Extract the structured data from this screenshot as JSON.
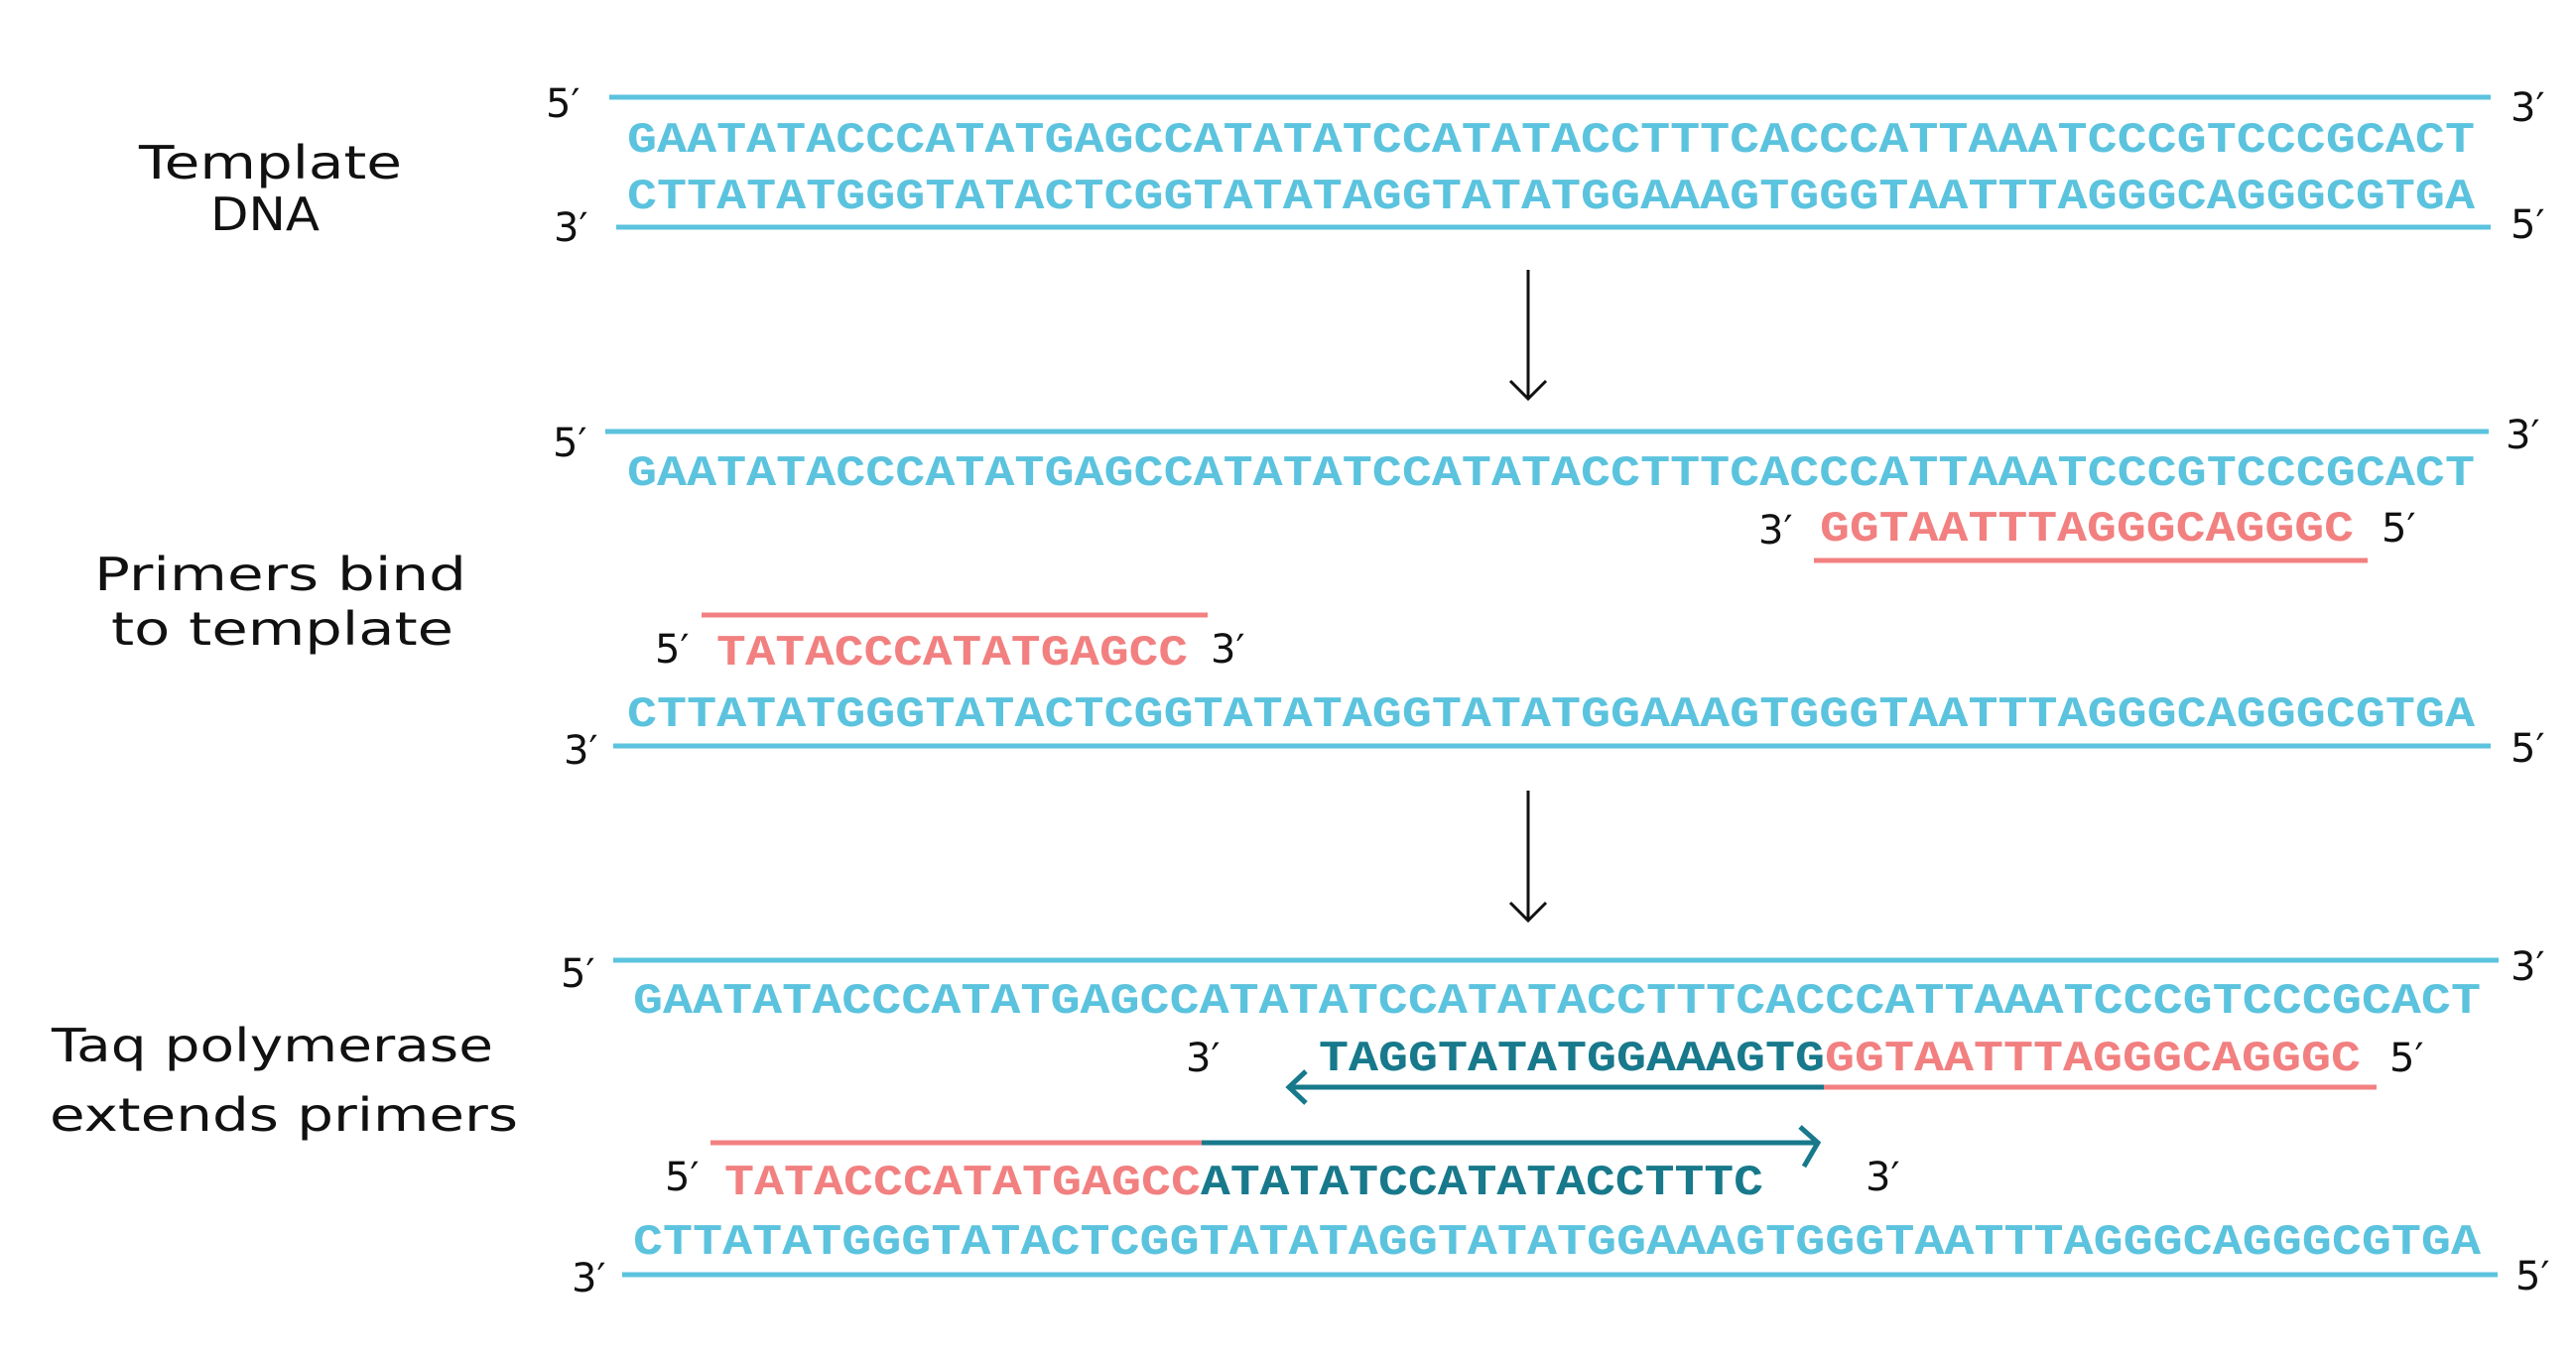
{
  "labels": {
    "step1": [
      "Template",
      "DNA"
    ],
    "step2": [
      "Primers  bind",
      "to template"
    ],
    "step3": [
      "Taq polymerase",
      "extends primers"
    ]
  },
  "primes": {
    "five": "5′",
    "three": "3′"
  },
  "sequences": {
    "top_strand": "GAATATACCCATATGAGCCATATATCCATATACCTTTCACCCATTAAATCCCGTCCCGCACT",
    "bottom_strand": "CTTATATGGGTATACTCGGTATATAGGTATATGGAAAGTGGGTAATTTAGGGCAGGGCGTGA",
    "reverse_primer": "GGTAATTTAGGGCAGGGC",
    "forward_primer": "TATACCCATATGAGCC",
    "reverse_extension": "TAGGTATATGGAAAGTG",
    "forward_extension": "ATATATCCATATACCTTTC"
  },
  "colors": {
    "template": "#5bc3de",
    "primer": "#f28080",
    "new_strand": "#17798b",
    "text": "#111111"
  }
}
